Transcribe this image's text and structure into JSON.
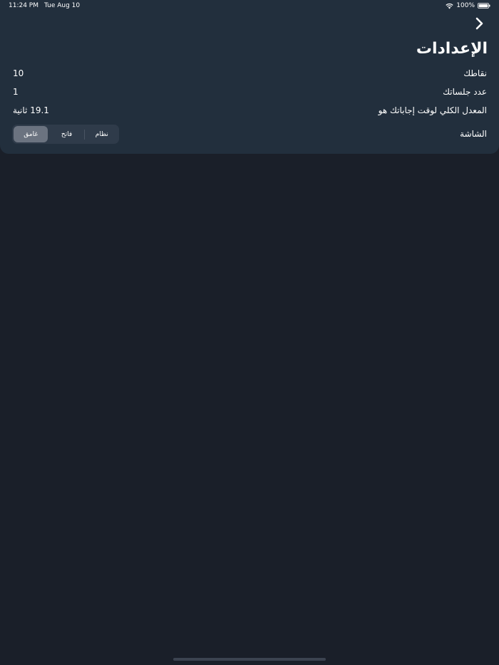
{
  "status_bar": {
    "time": "11:24 PM",
    "date": "Tue Aug 10",
    "battery": "100%",
    "wifi_icon": "wifi-icon",
    "battery_icon": "battery-icon"
  },
  "header": {
    "back_icon": "chevron-right-icon",
    "title": "الإعدادات"
  },
  "stats": {
    "points_label": "نقاطك",
    "points_value": "10",
    "sessions_label": "عدد جلساتك",
    "sessions_value": "1",
    "avg_label": "المعدل الكلي لوقت إجاباتك هو",
    "avg_value": "19.1 ثانية"
  },
  "theme": {
    "label": "الشاشة",
    "options": [
      "غامق",
      "فاتح",
      "نظام"
    ],
    "selected": "غامق"
  },
  "colors": {
    "background": "#1a1f29",
    "panel": "#222f3d",
    "segment_bg": "#2f3b4a",
    "segment_selected": "#6b7380"
  }
}
